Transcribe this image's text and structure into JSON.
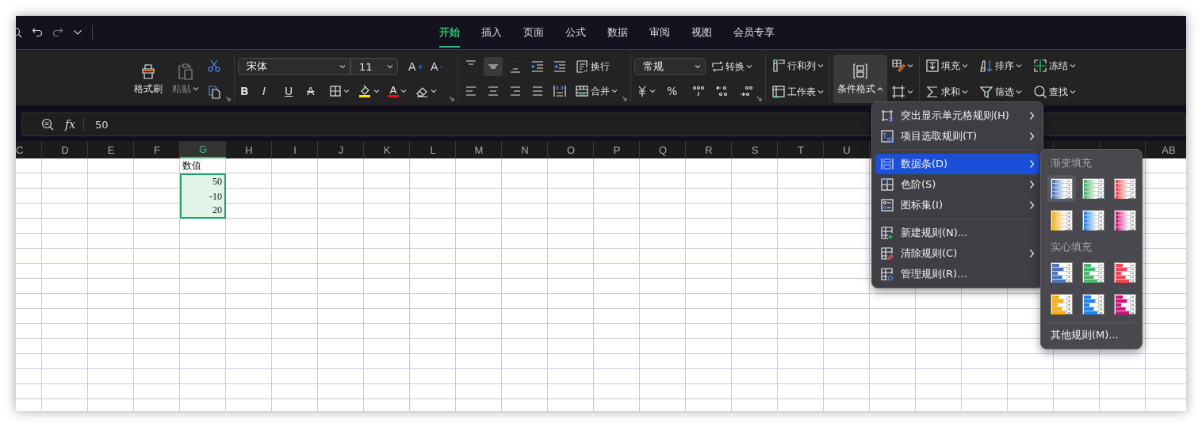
{
  "tabs": [
    {
      "label": "开始",
      "selected": true
    },
    {
      "label": "插入",
      "selected": false
    },
    {
      "label": "页面",
      "selected": false
    },
    {
      "label": "公式",
      "selected": false
    },
    {
      "label": "数据",
      "selected": false
    },
    {
      "label": "审阅",
      "selected": false
    },
    {
      "label": "视图",
      "selected": false
    },
    {
      "label": "会员专享",
      "selected": false
    }
  ],
  "ribbon": {
    "format_painter": "格式刷",
    "paste": {
      "label": "粘贴",
      "disabled": true
    },
    "font": {
      "value": "宋体"
    },
    "font_size": {
      "value": "11"
    },
    "grow_font": "A",
    "grow_font_sign": "+",
    "shrink_font": "A",
    "shrink_font_sign": "-",
    "text_styles": [
      {
        "kind": "bold",
        "label": "B"
      },
      {
        "kind": "italic",
        "label": "I"
      },
      {
        "kind": "underline",
        "label": "U"
      },
      {
        "kind": "strike",
        "label": "A"
      }
    ],
    "font_color": "A",
    "align_buttons": [
      {
        "kind": "top",
        "selected": false
      },
      {
        "kind": "middle",
        "selected": true
      },
      {
        "kind": "bottom",
        "selected": false
      },
      {
        "kind": "outdent",
        "selected": false
      },
      {
        "kind": "indent",
        "selected": false
      },
      {
        "kind": "left",
        "selected": false
      },
      {
        "kind": "center",
        "selected": false
      },
      {
        "kind": "right",
        "selected": false
      },
      {
        "kind": "justify",
        "selected": false
      },
      {
        "kind": "distribute",
        "selected": false
      }
    ],
    "wrap": "换行",
    "merge": "合并",
    "number_format": {
      "value": "常规"
    },
    "convert": "转换",
    "percent": "%",
    "rows_cols": "行和列",
    "sheet": "工作表",
    "conditional_format": {
      "label": "条件格式",
      "expanded": true
    },
    "fill": "填充",
    "sort": "排序",
    "freeze": "冻结",
    "sum": "求和",
    "filter": "筛选",
    "find": "查找"
  },
  "formula_bar": {
    "function_label": "fx",
    "value": "50"
  },
  "sheet": {
    "column_headers": [
      {
        "label": "C",
        "selected": false
      },
      {
        "label": "D",
        "selected": false
      },
      {
        "label": "E",
        "selected": false
      },
      {
        "label": "F",
        "selected": false
      },
      {
        "label": "G",
        "selected": true,
        "cells": [
          {
            "text": "数值",
            "kind": "text",
            "selected": false
          },
          {
            "text": "50",
            "kind": "number",
            "selected": true
          },
          {
            "text": "-10",
            "kind": "number",
            "selected": true
          },
          {
            "text": "20",
            "kind": "number",
            "selected": true
          }
        ]
      },
      {
        "label": "H",
        "selected": false
      },
      {
        "label": "I",
        "selected": false
      },
      {
        "label": "J",
        "selected": false
      },
      {
        "label": "K",
        "selected": false
      },
      {
        "label": "L",
        "selected": false
      },
      {
        "label": "M",
        "selected": false
      },
      {
        "label": "N",
        "selected": false
      },
      {
        "label": "O",
        "selected": false
      },
      {
        "label": "P",
        "selected": false
      },
      {
        "label": "Q",
        "selected": false
      },
      {
        "label": "R",
        "selected": false
      },
      {
        "label": "S",
        "selected": false
      },
      {
        "label": "T",
        "selected": false
      },
      {
        "label": "U",
        "selected": false
      }
    ],
    "column_headers_right": [
      {
        "label": "AB",
        "selected": false
      }
    ]
  },
  "menu": {
    "groups": [
      [
        {
          "kind": "highlight",
          "label": "突出显示单元格规则(H)",
          "submenu": true,
          "selected": false
        },
        {
          "kind": "top",
          "label": "项目选取规则(T)",
          "submenu": true,
          "selected": false
        }
      ],
      [
        {
          "kind": "databar",
          "label": "数据条(D)",
          "submenu": true,
          "selected": true
        },
        {
          "kind": "colorscale",
          "label": "色阶(S)",
          "submenu": true,
          "selected": false
        },
        {
          "kind": "iconset",
          "label": "图标集(I)",
          "submenu": true,
          "selected": false
        }
      ],
      [
        {
          "kind": "new",
          "label": "新建规则(N)...",
          "submenu": false,
          "selected": false
        },
        {
          "kind": "clear",
          "label": "清除规则(C)",
          "submenu": true,
          "selected": false
        },
        {
          "kind": "manage",
          "label": "管理规则(R)...",
          "submenu": false,
          "selected": false
        }
      ]
    ]
  },
  "submenu": {
    "sections": [
      {
        "heading": "渐变填充",
        "kind": "gradient",
        "swatches": [
          {
            "color": "#4a76c0",
            "selected": true
          },
          {
            "color": "#4cb86a",
            "selected": false
          },
          {
            "color": "#f0474f",
            "selected": false
          },
          {
            "color": "#f8b20c",
            "selected": false
          },
          {
            "color": "#1e82f0",
            "selected": false
          },
          {
            "color": "#d0127a",
            "selected": false
          }
        ]
      },
      {
        "heading": "实心填充",
        "kind": "solid",
        "swatches": [
          {
            "color": "#4a76c0",
            "selected": false
          },
          {
            "color": "#4cb86a",
            "selected": false
          },
          {
            "color": "#f0474f",
            "selected": false
          },
          {
            "color": "#f8b20c",
            "selected": false
          },
          {
            "color": "#1e82f0",
            "selected": false
          },
          {
            "color": "#d0127a",
            "selected": false
          }
        ]
      }
    ],
    "footer": "其他规则(M)..."
  }
}
